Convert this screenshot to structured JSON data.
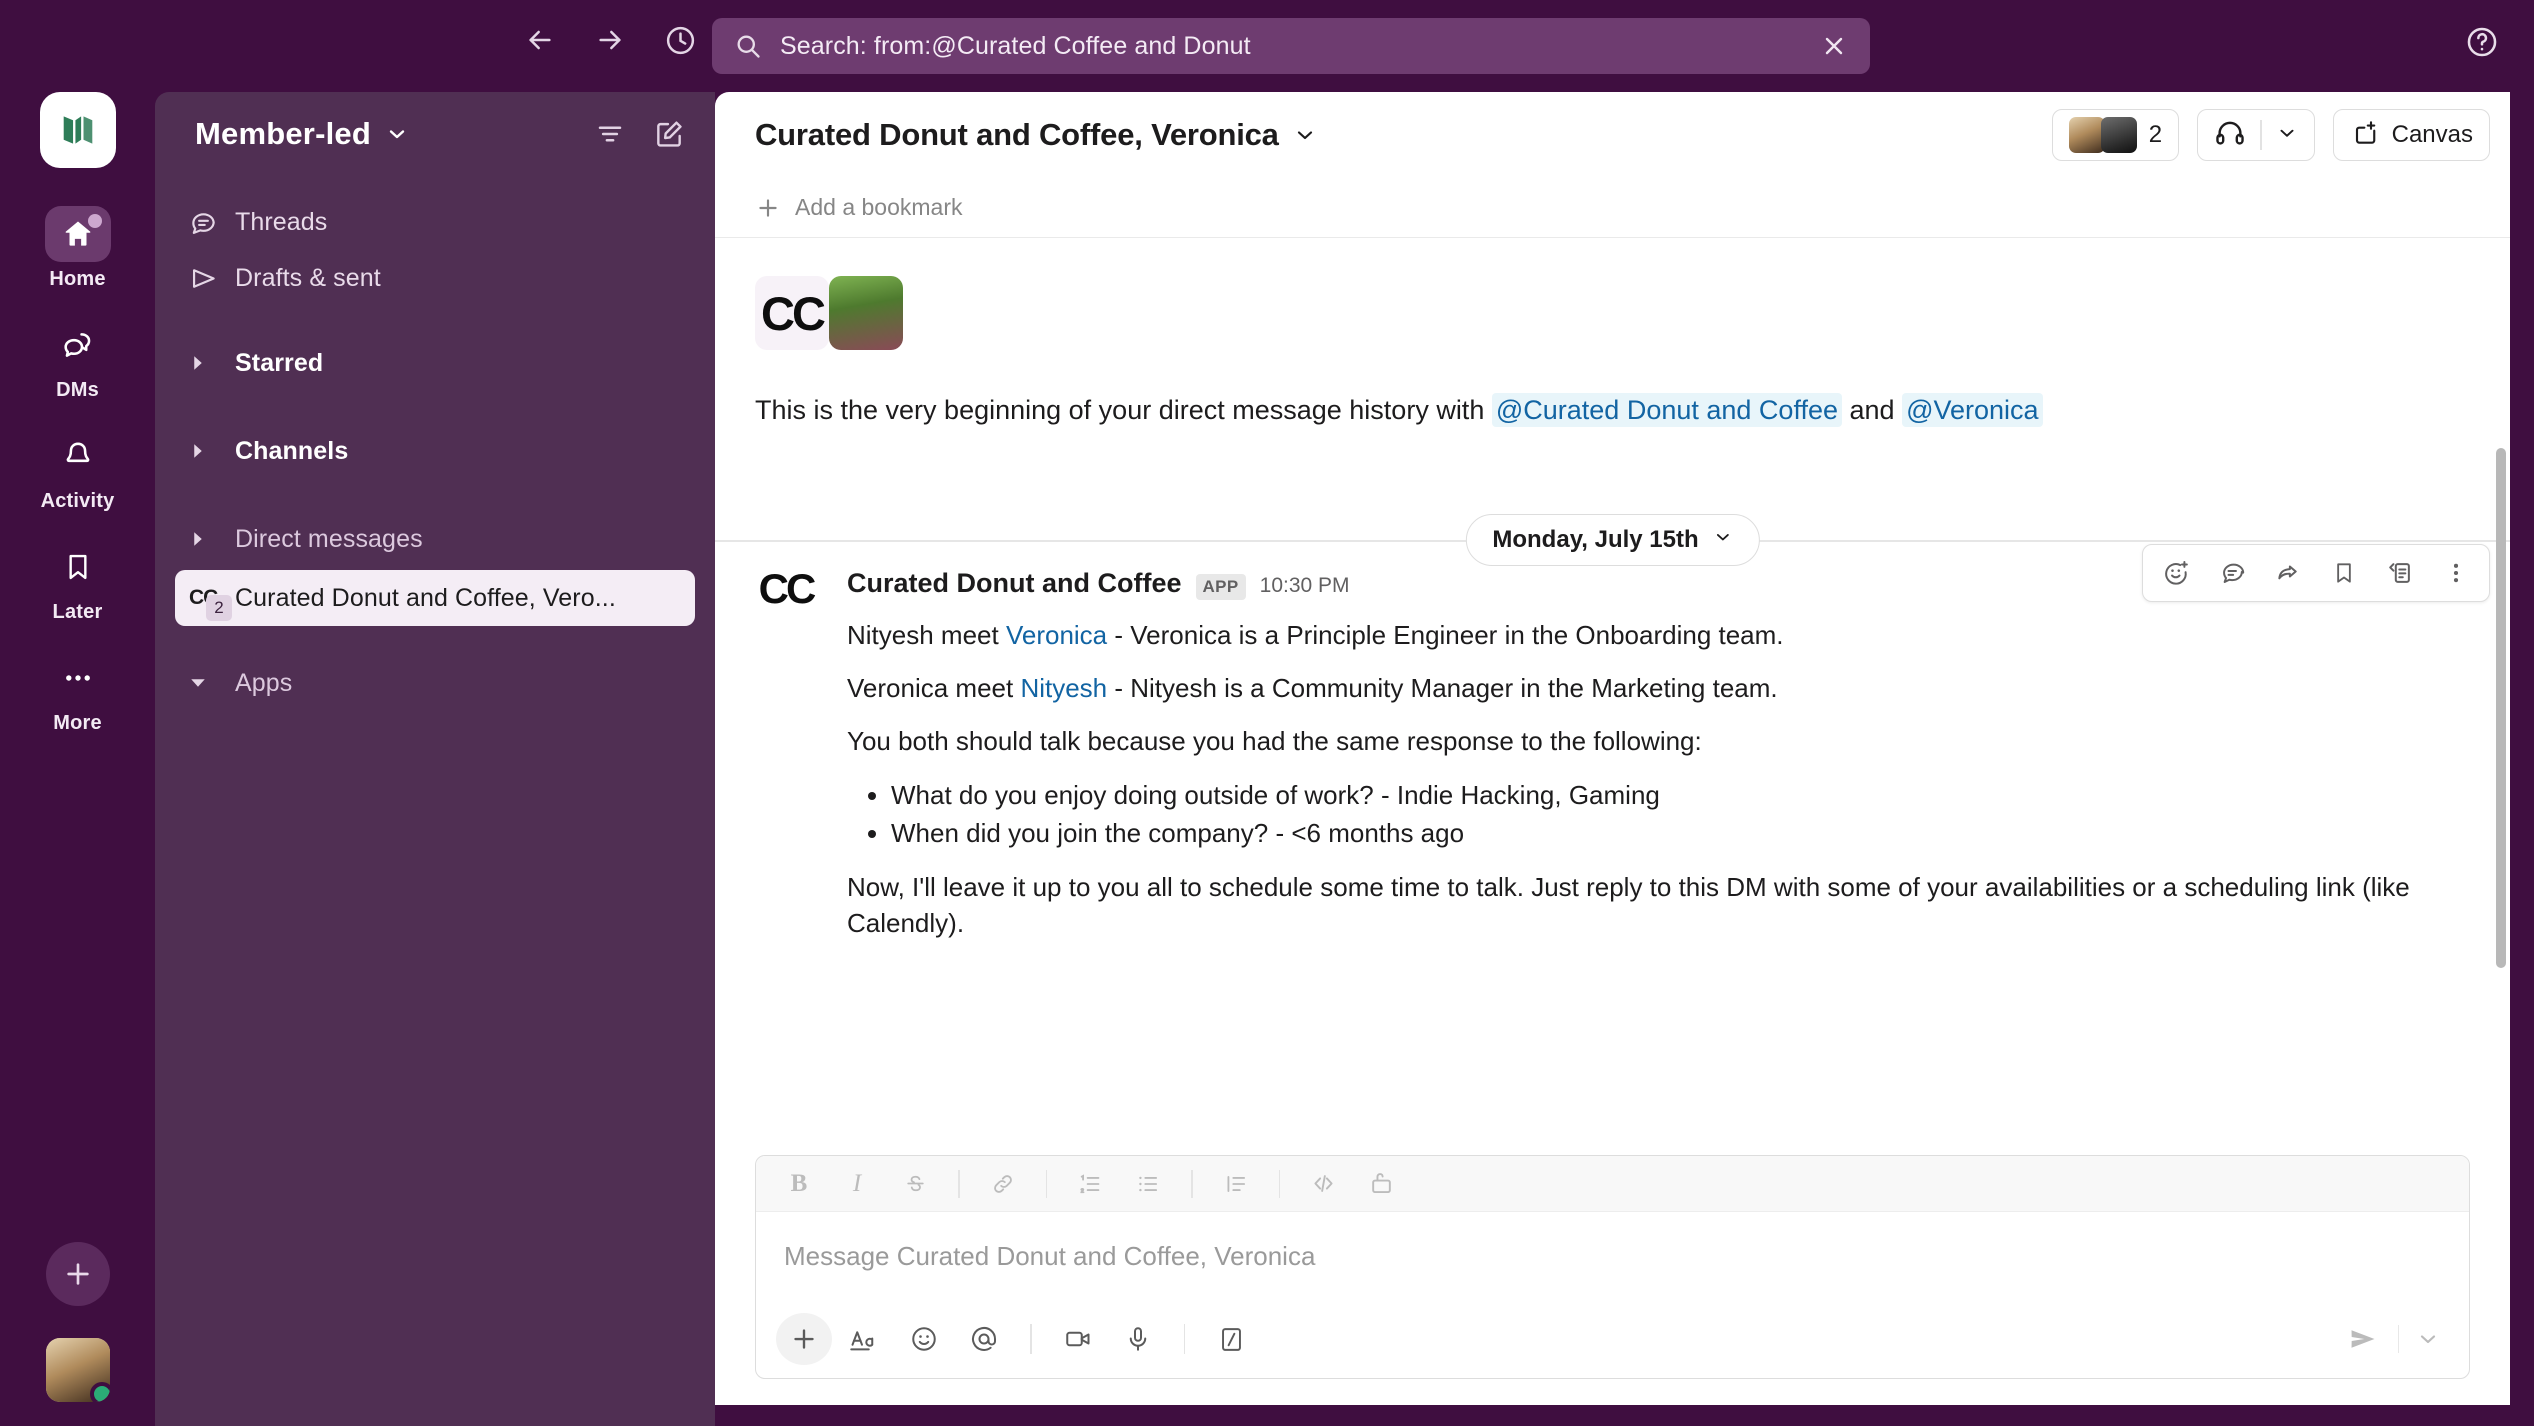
{
  "topbar": {
    "back_icon": "arrow-left-icon",
    "forward_icon": "arrow-right-icon",
    "history_icon": "clock-icon",
    "search_value": "Search: from:@Curated Coffee and Donut",
    "search_placeholder": "Search",
    "clear_label": "Clear search",
    "help_label": "Help"
  },
  "rail": {
    "workspace_name": "Member-led",
    "items": [
      {
        "label": "Home",
        "icon": "home-icon",
        "active": true,
        "badge": true
      },
      {
        "label": "DMs",
        "icon": "dms-icon",
        "active": false,
        "badge": false
      },
      {
        "label": "Activity",
        "icon": "bell-icon",
        "active": false,
        "badge": false
      },
      {
        "label": "Later",
        "icon": "bookmark-icon",
        "active": false,
        "badge": false
      },
      {
        "label": "More",
        "icon": "ellipsis-icon",
        "active": false,
        "badge": false
      }
    ],
    "add_label": "Create new",
    "user_avatar_label": "User profile",
    "presence": "active"
  },
  "sidebar": {
    "title": "Member-led",
    "filter_icon": "filter-icon",
    "compose_icon": "compose-icon",
    "rows": [
      {
        "label": "Threads",
        "icon": "threads-icon"
      },
      {
        "label": "Drafts & sent",
        "icon": "send-outline-icon"
      }
    ],
    "sections": [
      {
        "label": "Starred",
        "expanded": false,
        "style": "strong"
      },
      {
        "label": "Channels",
        "expanded": false,
        "style": "strong"
      },
      {
        "label": "Direct messages",
        "expanded": false,
        "style": "dim"
      }
    ],
    "dm": {
      "label": "Curated Donut and Coffee, Vero...",
      "initials": "CC",
      "count": "2",
      "selected": true
    },
    "apps_section": {
      "label": "Apps",
      "expanded": true,
      "style": "dim"
    }
  },
  "channel": {
    "title": "Curated Donut and Coffee, Veronica",
    "member_count": "2",
    "huddle_icon": "headphones-icon",
    "canvas_label": "Canvas",
    "bookmark_add_label": "Add a bookmark"
  },
  "intro": {
    "initials": "CC",
    "text_before": "This is the very beginning of your direct message history with",
    "mention_1": "@Curated Donut and Coffee",
    "conjunction": "and",
    "mention_2": "@Veronica"
  },
  "divider": {
    "label": "Monday, July 15th"
  },
  "message": {
    "sender": "Curated Donut and Coffee",
    "initials": "CC",
    "app_badge": "APP",
    "time": "10:30 PM",
    "line1_pre": "Nityesh meet ",
    "line1_link": "Veronica",
    "line1_post": " - Veronica is a Principle Engineer in the Onboarding team.",
    "line2_pre": "Veronica meet ",
    "line2_link": "Nityesh",
    "line2_post": " - Nityesh is a Community Manager in the Marketing team.",
    "line3": "You both should talk because you had the same response to the following:",
    "bullets": [
      "What do you enjoy doing outside of work? - Indie Hacking, Gaming",
      "When did you join the company? - <6 months ago"
    ],
    "line4": "Now, I'll leave it up to you all to schedule some time to talk. Just reply to this DM with some of your availabilities or a scheduling link (like Calendly).",
    "hover_tools": [
      {
        "name": "add-reaction-icon",
        "label": "Add reaction"
      },
      {
        "name": "reply-in-thread-icon",
        "label": "Reply in thread"
      },
      {
        "name": "forward-icon",
        "label": "Forward message"
      },
      {
        "name": "save-for-later-icon",
        "label": "Save for later"
      },
      {
        "name": "add-to-list-icon",
        "label": "Add to list"
      },
      {
        "name": "more-actions-icon",
        "label": "More actions"
      }
    ]
  },
  "composer": {
    "placeholder": "Message Curated Donut and Coffee, Veronica",
    "format_tools": [
      {
        "name": "bold-icon",
        "label": "Bold"
      },
      {
        "name": "italic-icon",
        "label": "Italic"
      },
      {
        "name": "strikethrough-icon",
        "label": "Strikethrough"
      },
      {
        "name": "link-icon",
        "label": "Link"
      },
      {
        "name": "ordered-list-icon",
        "label": "Ordered list"
      },
      {
        "name": "bulleted-list-icon",
        "label": "Bulleted list"
      },
      {
        "name": "blockquote-icon",
        "label": "Blockquote"
      },
      {
        "name": "code-icon",
        "label": "Code"
      },
      {
        "name": "code-block-icon",
        "label": "Code block"
      }
    ],
    "action_tools": [
      {
        "name": "plus-icon",
        "label": "Attach"
      },
      {
        "name": "formatting-icon",
        "label": "Formatting"
      },
      {
        "name": "emoji-icon",
        "label": "Emoji"
      },
      {
        "name": "mention-icon",
        "label": "Mention someone"
      },
      {
        "name": "video-icon",
        "label": "Record video clip"
      },
      {
        "name": "mic-icon",
        "label": "Record audio clip"
      },
      {
        "name": "slash-command-icon",
        "label": "Shortcuts"
      }
    ],
    "send_label": "Send"
  },
  "colors": {
    "workspace_purple": "#3F0E40",
    "sidebar_purple": "#502F53",
    "search_purple": "#6E3C70",
    "link_blue": "#1264A3",
    "mention_bg": "#E8F5FA",
    "presence_green": "#2BAC76",
    "logo_green": "#2E7D58"
  }
}
